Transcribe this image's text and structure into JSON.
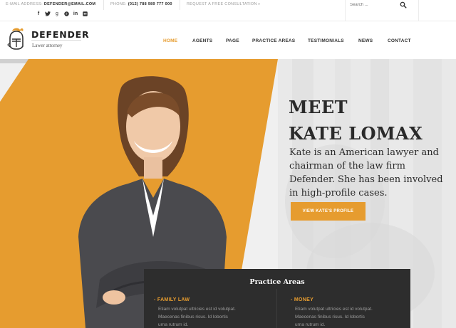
{
  "topbar": {
    "email_label": "E-MAIL ADDRESS:",
    "email_value": "DEFENDER@EMAIL.COM",
    "phone_label": "PHONE:",
    "phone_value": "(012) 788 989 777 000",
    "consultation": "REQUEST A FREE CONSULTATION",
    "consultation_arrow": "›",
    "social_icons": [
      "facebook-icon",
      "twitter-icon",
      "google-plus-icon",
      "pinterest-icon",
      "linkedin-icon",
      "flickr-icon"
    ],
    "social_glyphs": [
      "f",
      "y",
      "g",
      "p",
      "in",
      "◉"
    ]
  },
  "search": {
    "placeholder": "Search ..."
  },
  "logo": {
    "title": "DEFENDER",
    "tagline": "Lawer attorney"
  },
  "nav": {
    "items": [
      "HOME",
      "AGENTS",
      "PAGE",
      "PRACTICE AREAS",
      "TESTIMONIALS",
      "NEWS",
      "CONTACT"
    ],
    "active": "HOME"
  },
  "hero": {
    "heading_line1": "MEET",
    "heading_line2": "KATE LOMAX",
    "description": "Kate is an American lawyer and chairman of the law firm Defender. She has been involved in high-profile cases.",
    "button": "VIEW KATE'S PROFILE"
  },
  "practice": {
    "title": "Practice Areas",
    "areas": [
      {
        "name": "FAMILY LAW",
        "lines": [
          "Etiam volutpat ultricies est id volutpat.",
          "Maecenas finibus risus. Id lobortis",
          "urna rutrum id."
        ]
      },
      {
        "name": "MONEY",
        "lines": [
          "Etiam volutpat ultricies est id volutpat.",
          "Maecenas finibus risus. Id lobortis",
          "urna rutrum id."
        ]
      }
    ]
  },
  "colors": {
    "accent": "#e69c2f",
    "dark_panel": "#2d2d2d",
    "text_dark": "#2a2a2a"
  }
}
